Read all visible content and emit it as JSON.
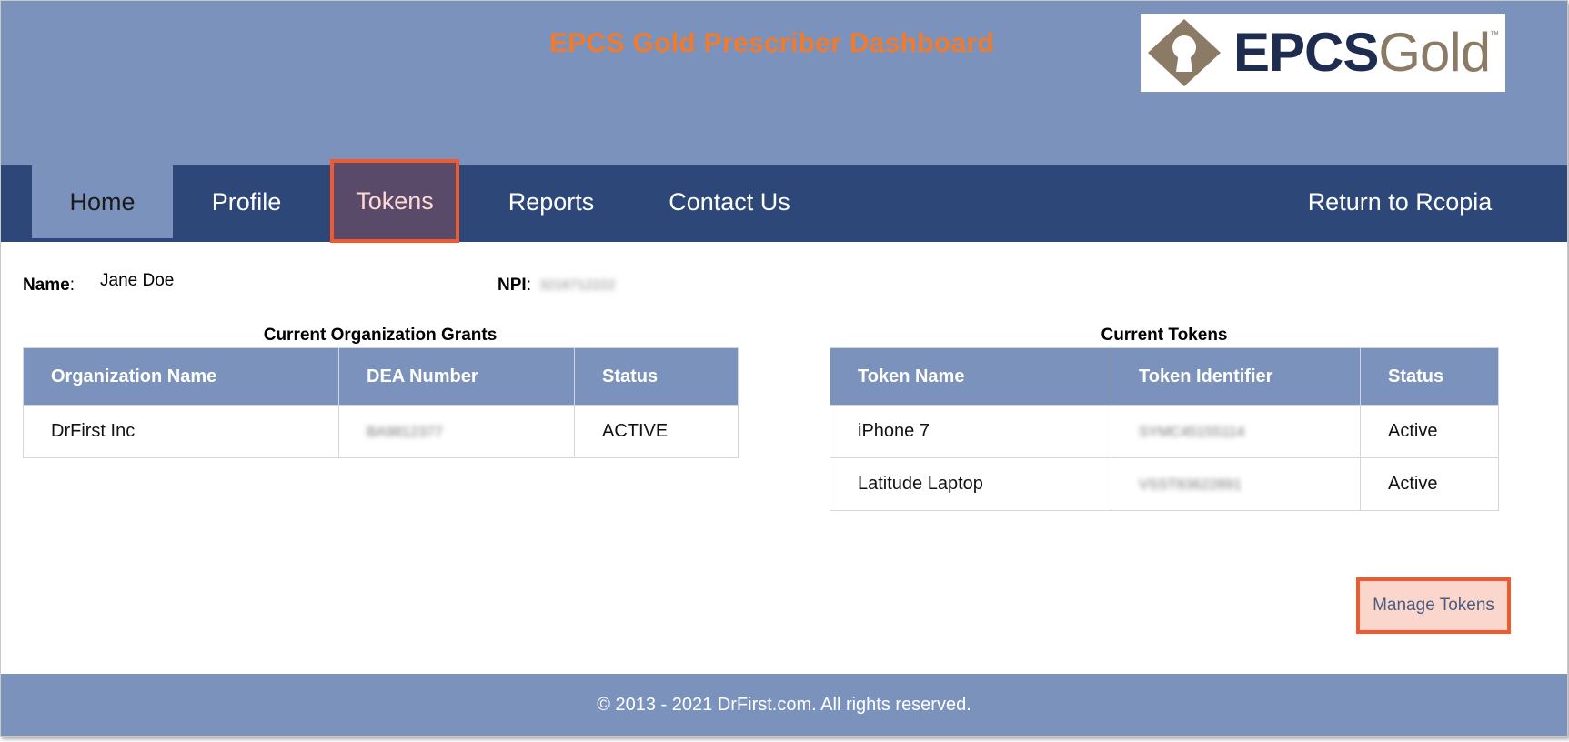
{
  "header": {
    "title": "EPCS Gold Prescriber Dashboard",
    "logo": {
      "epcs": "EPCS",
      "gold": "Gold",
      "tm": "™",
      "icon": "keyhole-diamond-icon"
    }
  },
  "nav": {
    "home": "Home",
    "profile": "Profile",
    "tokens": "Tokens",
    "reports": "Reports",
    "contact": "Contact Us",
    "return": "Return to Rcopia"
  },
  "user": {
    "name_label": "Name",
    "name_value": "Jane Doe",
    "npi_label": "NPI",
    "npi_value": "3216712222"
  },
  "grants": {
    "title": "Current Organization Grants",
    "headers": [
      "Organization Name",
      "DEA Number",
      "Status"
    ],
    "rows": [
      [
        "DrFirst Inc",
        "BA9812377",
        "ACTIVE"
      ]
    ]
  },
  "tokens": {
    "title": "Current Tokens",
    "headers": [
      "Token Name",
      "Token Identifier",
      "Status"
    ],
    "rows": [
      [
        "iPhone 7",
        "SYMC45155114",
        "Active"
      ],
      [
        "Latitude Laptop",
        "VSST83622891",
        "Active"
      ]
    ]
  },
  "manage_button": "Manage Tokens",
  "footer": "© 2013 - 2021 DrFirst.com. All rights reserved.",
  "colors": {
    "header_bg": "#7b93bc",
    "nav_bg": "#2d4779",
    "title_orange": "#f07b2e",
    "highlight_border": "#f05a30"
  }
}
